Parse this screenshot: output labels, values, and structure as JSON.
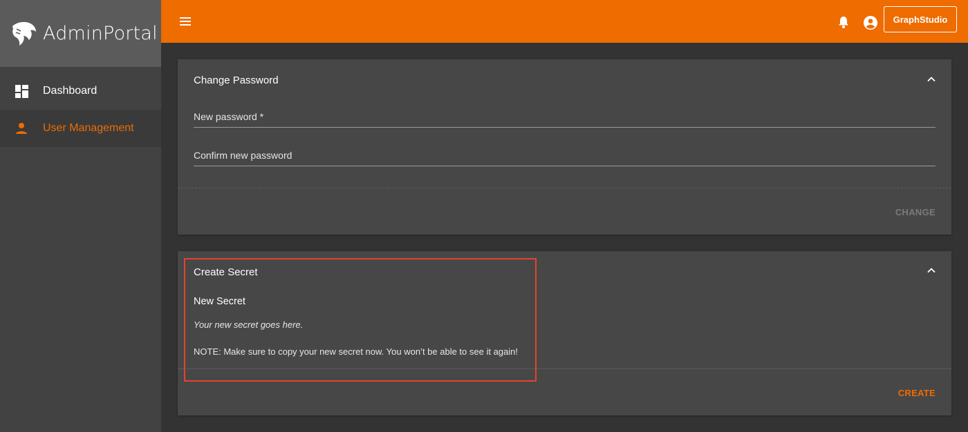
{
  "brand": {
    "name": "AdminPortal",
    "logo_icon": "tiger-logo-icon"
  },
  "sidebar": {
    "items": [
      {
        "label": "Dashboard",
        "icon": "dashboard-icon",
        "active": false
      },
      {
        "label": "User Management",
        "icon": "person-icon",
        "active": true
      }
    ]
  },
  "topbar": {
    "menu_icon": "hamburger-menu-icon",
    "notifications_icon": "bell-icon",
    "account_icon": "account-circle-icon",
    "app_button_label": "GraphStudio"
  },
  "change_password": {
    "title": "Change Password",
    "new_password_label": "New password *",
    "new_password_value": "",
    "confirm_password_label": "Confirm new password",
    "confirm_password_value": "",
    "action_label": "CHANGE",
    "action_enabled": false
  },
  "create_secret": {
    "title": "Create Secret",
    "heading": "New Secret",
    "secret_placeholder": "Your new secret goes here.",
    "note": "NOTE: Make sure to copy your new secret now. You won’t be able to see it again!",
    "action_label": "CREATE",
    "action_enabled": true
  },
  "colors": {
    "accent": "#ee6c00",
    "sidebar_bg": "#424242",
    "brand_bg": "#5b5b5b",
    "content_bg": "#333333",
    "card_bg": "#474747",
    "highlight_border": "#e2452a"
  }
}
